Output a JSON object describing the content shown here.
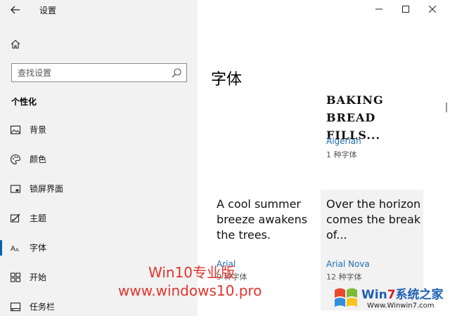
{
  "titlebar": {
    "back_icon": "arrow-left-icon",
    "app_title": "设置",
    "controls": [
      "minimize-icon",
      "maximize-icon",
      "close-icon"
    ]
  },
  "sidebar": {
    "home_icon": "home-icon",
    "search": {
      "placeholder": "查找设置",
      "icon": "search-icon"
    },
    "section_title": "个性化",
    "items": [
      {
        "label": "背景",
        "icon": "picture-icon"
      },
      {
        "label": "颜色",
        "icon": "palette-icon"
      },
      {
        "label": "锁屏界面",
        "icon": "lock-screen-icon"
      },
      {
        "label": "主题",
        "icon": "theme-icon"
      },
      {
        "label": "字体",
        "icon": "font-icon",
        "selected": true
      },
      {
        "label": "开始",
        "icon": "start-icon"
      },
      {
        "label": "任务栏",
        "icon": "taskbar-icon"
      }
    ]
  },
  "main": {
    "title": "字体",
    "font_cards": [
      {
        "preview": "Baking Bread fills...",
        "name": "Algerian",
        "count": "1 种字体",
        "highlighted": false
      },
      {
        "preview": "A cool summer breeze awakens the trees.",
        "name": "Arial",
        "count": "9 种字体",
        "highlighted": false
      },
      {
        "preview": "Over the horizon comes the break of...",
        "name": "Arial Nova",
        "count": "12 种字体",
        "highlighted": true
      }
    ]
  },
  "watermark": {
    "line1": "Win10专业版",
    "line2": "www.windows10.pro"
  },
  "logo": {
    "brand_prefix": "Win",
    "brand_number": "7",
    "brand_suffix": "系统之家",
    "url": "Www.Winwin7.com"
  },
  "colors": {
    "sidebar_bg": "#f2f2f2",
    "accent": "#0063b1",
    "link": "#1f6fb2",
    "card_highlight": "#f2f2f2",
    "watermark": "#e0352d"
  }
}
